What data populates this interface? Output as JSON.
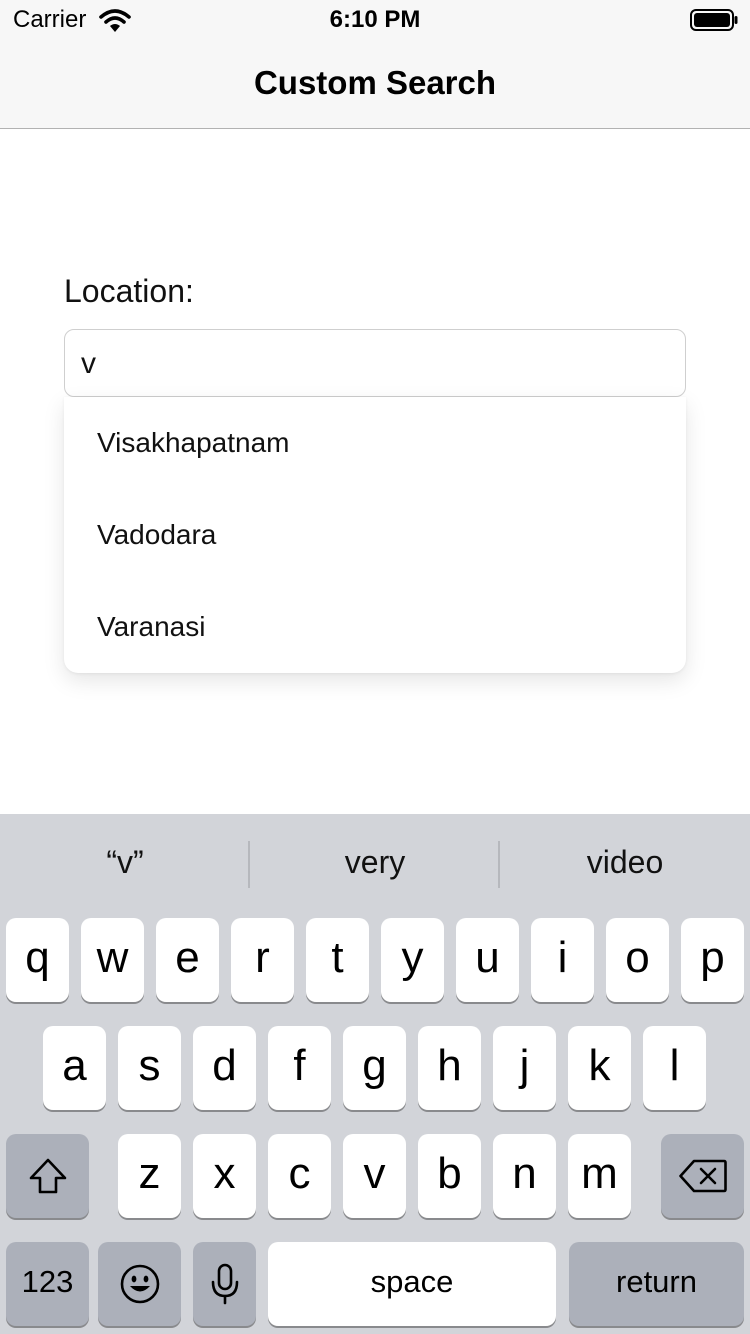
{
  "status_bar": {
    "carrier": "Carrier",
    "time": "6:10 PM"
  },
  "nav": {
    "title": "Custom Search"
  },
  "form": {
    "location_label": "Location:",
    "search_value": "v",
    "suggestions": [
      "Visakhapatnam",
      "Vadodara",
      "Varanasi"
    ]
  },
  "keyboard": {
    "predictions": [
      "“v”",
      "very",
      "video"
    ],
    "row1": [
      "q",
      "w",
      "e",
      "r",
      "t",
      "y",
      "u",
      "i",
      "o",
      "p"
    ],
    "row2": [
      "a",
      "s",
      "d",
      "f",
      "g",
      "h",
      "j",
      "k",
      "l"
    ],
    "row3": [
      "z",
      "x",
      "c",
      "v",
      "b",
      "n",
      "m"
    ],
    "numbers_key": "123",
    "space_key": "space",
    "return_key": "return"
  },
  "colors": {
    "bar_background": "#f7f7f7",
    "keyboard_background": "#d2d4d9",
    "key_light": "#ffffff",
    "key_dark": "#acb0ba"
  }
}
